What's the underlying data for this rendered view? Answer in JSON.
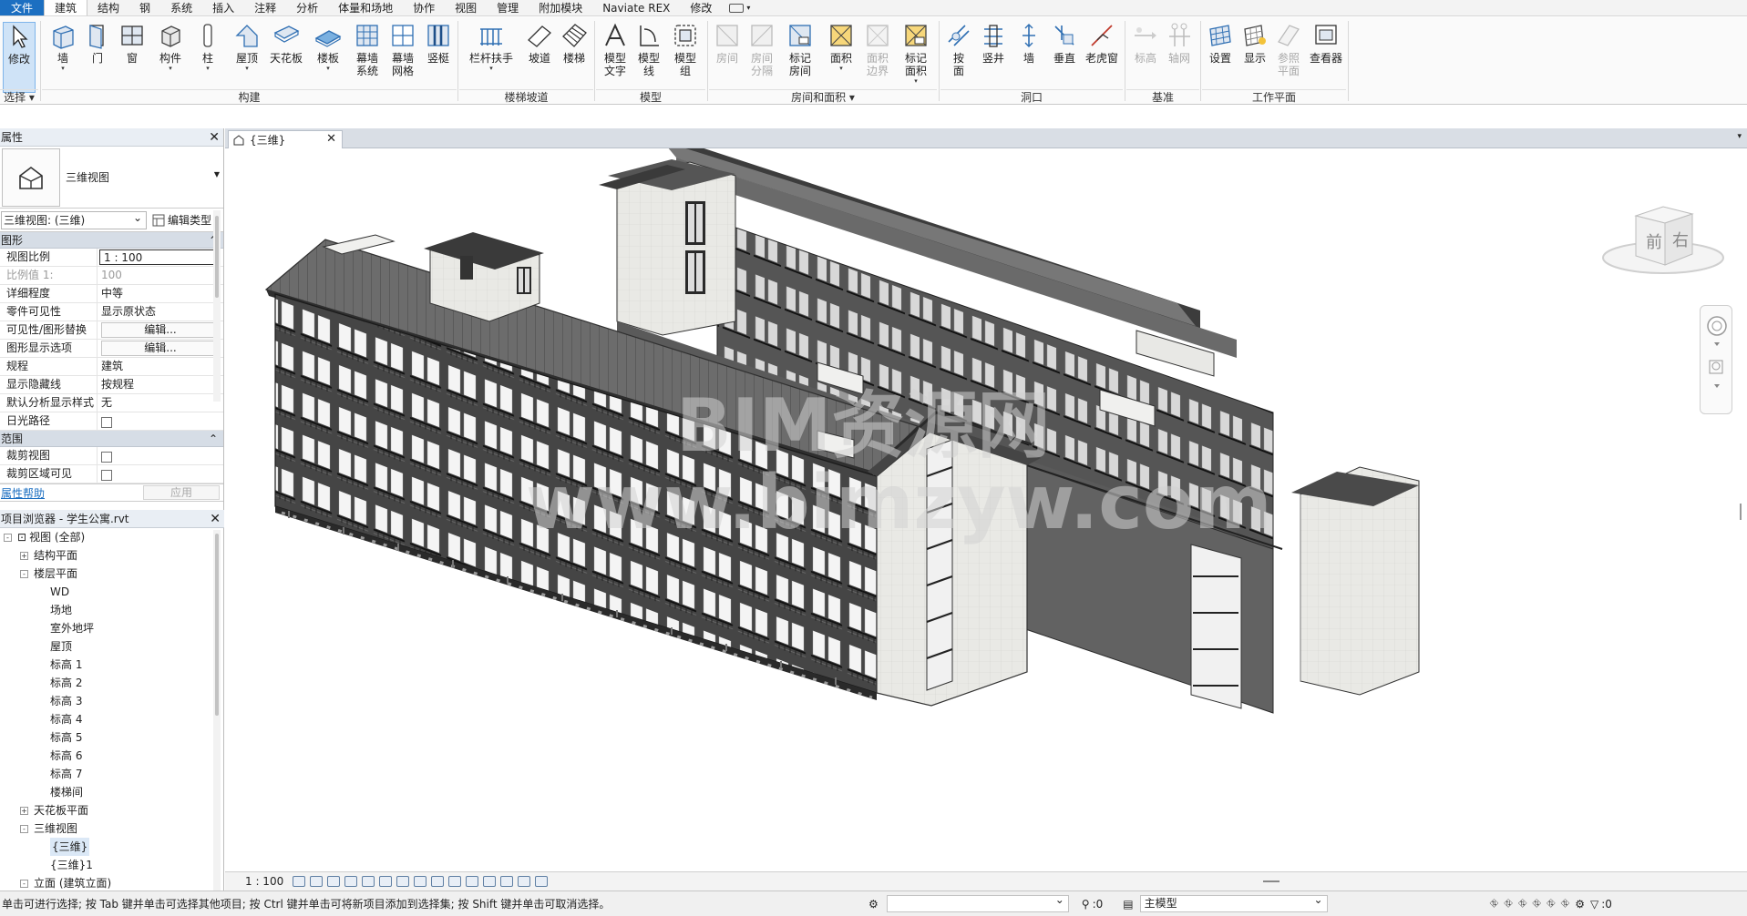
{
  "menu": {
    "tabs": [
      "文件",
      "建筑",
      "结构",
      "钢",
      "系统",
      "插入",
      "注释",
      "分析",
      "体量和场地",
      "协作",
      "视图",
      "管理",
      "附加模块",
      "Naviate REX",
      "修改"
    ],
    "active_tab": "建筑"
  },
  "ribbon": {
    "buttons": {
      "modify": "修改",
      "wall": "墙",
      "door": "门",
      "window": "窗",
      "component": "构件",
      "column": "柱",
      "roof": "屋顶",
      "ceiling": "天花板",
      "floor": "楼板",
      "curtain_system_1": "幕墙",
      "curtain_system_2": "系统",
      "curtain_grid_1": "幕墙",
      "curtain_grid_2": "网格",
      "mullion": "竖梃",
      "railing": "栏杆扶手",
      "ramp": "坡道",
      "stair": "楼梯",
      "model_text_1": "模型",
      "model_text_2": "文字",
      "model_line_1": "模型",
      "model_line_2": "线",
      "model_group_1": "模型",
      "model_group_2": "组",
      "room": "房间",
      "room_sep_1": "房间",
      "room_sep_2": "分隔",
      "tag_room_1": "标记",
      "tag_room_2": "房间",
      "area": "面积",
      "area_boundary_1": "面积",
      "area_boundary_2": "边界",
      "tag_area_1": "标记",
      "tag_area_2": "面积",
      "by_face_1": "按",
      "by_face_2": "面",
      "shaft": "竖井",
      "op_wall": "墙",
      "vertical": "垂直",
      "dormer": "老虎窗",
      "level": "标高",
      "grid": "轴网",
      "set": "设置",
      "show": "显示",
      "ref_plane_1": "参照",
      "ref_plane_2": "平面",
      "viewer": "查看器"
    },
    "panels": {
      "select": "选择",
      "build": "构建",
      "circulation": "楼梯坡道",
      "model": "模型",
      "room_area": "房间和面积",
      "opening": "洞口",
      "datum": "基准",
      "work_plane": "工作平面"
    }
  },
  "properties": {
    "title": "属性",
    "type_name": "三维视图",
    "selector": "三维视图: (三维)",
    "edit_type": "编辑类型",
    "group_graphics": "图形",
    "rows": [
      {
        "k": "视图比例",
        "v": "1 : 100"
      },
      {
        "k": "比例值 1:",
        "v": "100"
      },
      {
        "k": "详细程度",
        "v": "中等"
      },
      {
        "k": "零件可见性",
        "v": "显示原状态"
      },
      {
        "k": "可见性/图形替换",
        "v": "编辑..."
      },
      {
        "k": "图形显示选项",
        "v": "编辑..."
      },
      {
        "k": "规程",
        "v": "建筑"
      },
      {
        "k": "显示隐藏线",
        "v": "按规程"
      },
      {
        "k": "默认分析显示样式",
        "v": "无"
      },
      {
        "k": "日光路径",
        "v": ""
      }
    ],
    "group_extents": "范围",
    "extent_rows": [
      {
        "k": "裁剪视图",
        "v": ""
      },
      {
        "k": "裁剪区域可见",
        "v": ""
      }
    ],
    "help": "属性帮助",
    "apply": "应用"
  },
  "browser": {
    "title": "项目浏览器 - 学生公寓.rvt",
    "nodes": [
      {
        "label": "视图 (全部)",
        "level": 0,
        "toggle": "-"
      },
      {
        "label": "结构平面",
        "level": 1,
        "toggle": "+"
      },
      {
        "label": "楼层平面",
        "level": 1,
        "toggle": "-"
      },
      {
        "label": "WD",
        "level": 2,
        "toggle": ""
      },
      {
        "label": "场地",
        "level": 2,
        "toggle": ""
      },
      {
        "label": "室外地坪",
        "level": 2,
        "toggle": ""
      },
      {
        "label": "屋顶",
        "level": 2,
        "toggle": ""
      },
      {
        "label": "标高 1",
        "level": 2,
        "toggle": ""
      },
      {
        "label": "标高 2",
        "level": 2,
        "toggle": ""
      },
      {
        "label": "标高 3",
        "level": 2,
        "toggle": ""
      },
      {
        "label": "标高 4",
        "level": 2,
        "toggle": ""
      },
      {
        "label": "标高 5",
        "level": 2,
        "toggle": ""
      },
      {
        "label": "标高 6",
        "level": 2,
        "toggle": ""
      },
      {
        "label": "标高 7",
        "level": 2,
        "toggle": ""
      },
      {
        "label": "楼梯间",
        "level": 2,
        "toggle": ""
      },
      {
        "label": "天花板平面",
        "level": 1,
        "toggle": "+"
      },
      {
        "label": "三维视图",
        "level": 1,
        "toggle": "-"
      },
      {
        "label": "{三维}",
        "level": 2,
        "toggle": ""
      },
      {
        "label": "{三维}1",
        "level": 2,
        "toggle": ""
      },
      {
        "label": "立面 (建筑立面)",
        "level": 1,
        "toggle": "-"
      }
    ]
  },
  "view": {
    "tab_label": "{三维}",
    "watermark_line1": "BIM资源网",
    "watermark_line2": "www.bimzyw.com",
    "viewcube_front": "前",
    "viewcube_right": "右",
    "scale": "1 : 100"
  },
  "status": {
    "message": "单击可进行选择; 按 Tab 键并单击可选择其他项目; 按 Ctrl 键并单击可将新项目添加到选择集; 按 Shift 键并单击可取消选择。",
    "worksets_count": ":0",
    "design_option": "主模型",
    "filter_count": ":0"
  },
  "colors": {
    "file_tab": "#1c6fc1",
    "ribbon_icon_blue": "#2f6fb3",
    "building_dark": "#4a4a4a",
    "building_light": "#e4e4e0"
  }
}
